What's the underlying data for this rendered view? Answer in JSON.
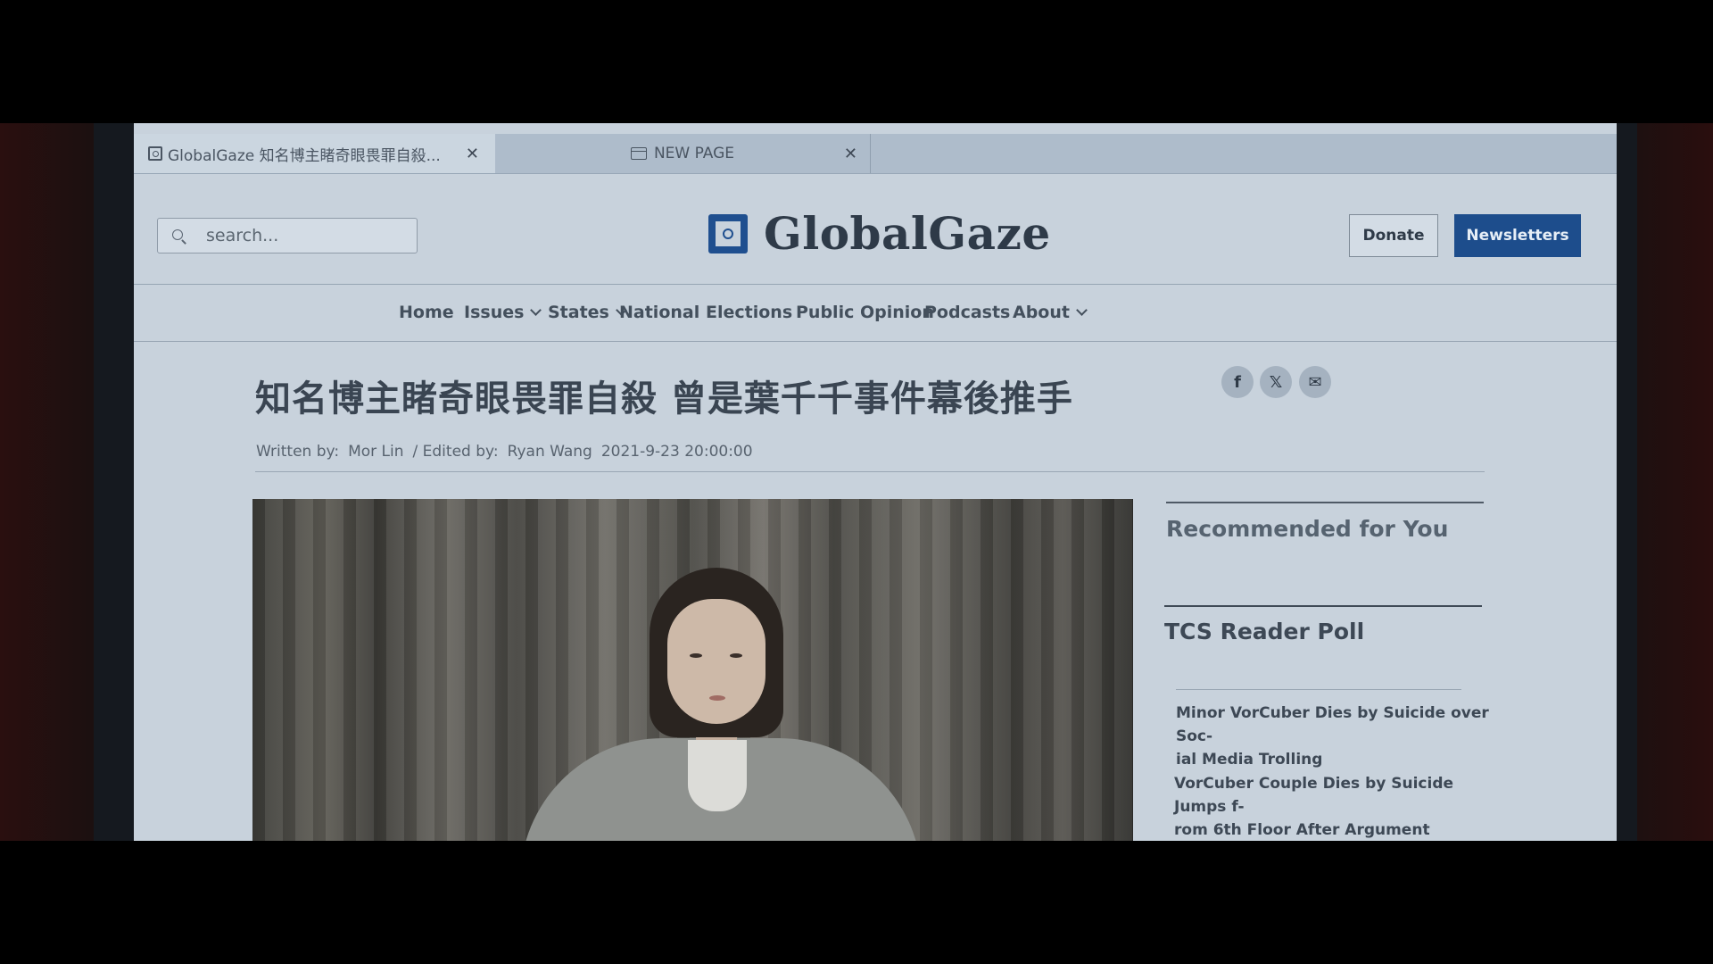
{
  "tabs": [
    {
      "title": "GlobalGaze  知名博主睹奇眼畏罪自殺...",
      "close": "✕",
      "active": true
    },
    {
      "title": "NEW PAGE",
      "close": "✕",
      "active": false
    }
  ],
  "header": {
    "search_placeholder": "search...",
    "logo_text": "GlobalGaze",
    "donate_label": "Donate",
    "newsletters_label": "Newsletters"
  },
  "nav": {
    "items": [
      {
        "label": "Home",
        "dropdown": false
      },
      {
        "label": "Issues",
        "dropdown": true
      },
      {
        "label": "States",
        "dropdown": true
      },
      {
        "label": "National",
        "dropdown": false
      },
      {
        "label": "Elections",
        "dropdown": false
      },
      {
        "label": "Public Opinion",
        "dropdown": false
      },
      {
        "label": "Podcasts",
        "dropdown": false
      },
      {
        "label": "About",
        "dropdown": true
      }
    ]
  },
  "article": {
    "headline": "知名博主睹奇眼畏罪自殺 曾是葉千千事件幕後推手",
    "written_by_label": "Written by:",
    "author": "Mor Lin",
    "edited_by_label": "/ Edited by:",
    "editor": "Ryan Wang",
    "date": "2021-9-23 20:00:00",
    "share": {
      "facebook": "f",
      "x": "𝕏",
      "email": "✉"
    }
  },
  "sidebar": {
    "recommended_title": "Recommended for You",
    "poll_title": "TCS Reader Poll",
    "stories": [
      {
        "line1": "Minor VorCuber Dies by Suicide over Soc-",
        "line2": "ial Media Trolling"
      },
      {
        "line1": "VorCuber Couple Dies by Suicide Jumps f-",
        "line2": "rom 6th Floor After Argument"
      }
    ]
  },
  "colors": {
    "brand": "#1d4d8c",
    "page_bg": "#c8d2dc",
    "text": "#3a4552"
  }
}
